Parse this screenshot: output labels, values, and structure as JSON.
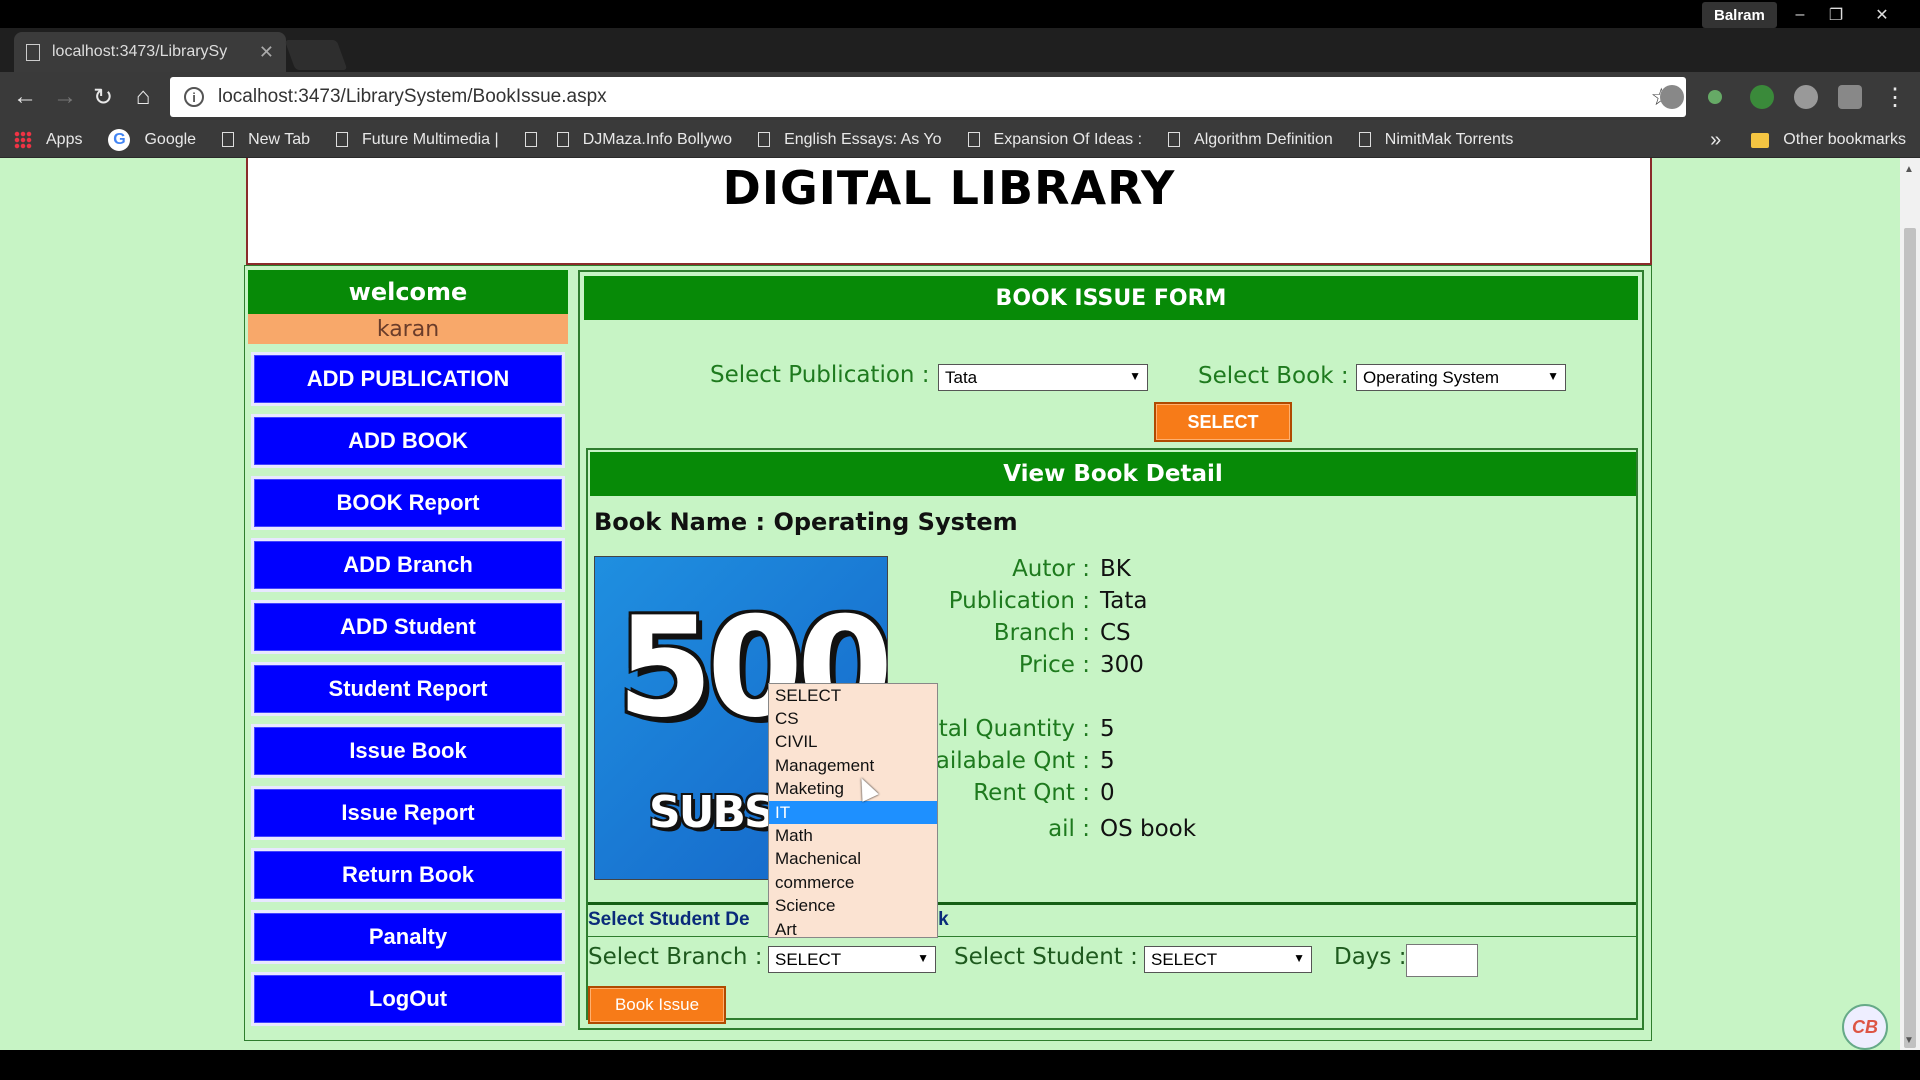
{
  "browser": {
    "tab_title": "localhost:3473/LibrarySy",
    "profile_name": "Balram",
    "url": "localhost:3473/LibrarySystem/BookIssue.aspx",
    "bookmarks": [
      {
        "label": "Apps"
      },
      {
        "label": "Google"
      },
      {
        "label": "New Tab"
      },
      {
        "label": "Future Multimedia |"
      },
      {
        "label": ""
      },
      {
        "label": "DJMaza.Info Bollywo"
      },
      {
        "label": "English Essays: As Yo"
      },
      {
        "label": "Expansion Of Ideas :"
      },
      {
        "label": "Algorithm Definition"
      },
      {
        "label": "NimitMak Torrents"
      }
    ],
    "overflow_label": "»",
    "other_bookmarks": "Other bookmarks"
  },
  "page": {
    "title": "DIGITAL LIBRARY"
  },
  "sidebar": {
    "welcome": "welcome",
    "username": "karan",
    "items": [
      {
        "label": "ADD PUBLICATION"
      },
      {
        "label": "ADD BOOK"
      },
      {
        "label": "BOOK Report"
      },
      {
        "label": "ADD Branch"
      },
      {
        "label": "ADD Student"
      },
      {
        "label": "Student Report"
      },
      {
        "label": "Issue Book"
      },
      {
        "label": "Issue Report"
      },
      {
        "label": "Return Book"
      },
      {
        "label": "Panalty"
      },
      {
        "label": "LogOut"
      }
    ]
  },
  "form": {
    "heading": "BOOK ISSUE FORM",
    "publication_label": "Select Publication :",
    "publication_value": "Tata",
    "book_label": "Select Book :",
    "book_value": "Operating System",
    "select_button": "SELECT"
  },
  "detail": {
    "heading": "View Book Detail",
    "book_name": "Book Name : Operating System",
    "cover_big": "500!",
    "cover_sub": "SUBSCRI",
    "rows": [
      {
        "key": "Autor :",
        "value": "BK"
      },
      {
        "key": "Publication :",
        "value": "Tata"
      },
      {
        "key": "Branch :",
        "value": "CS"
      },
      {
        "key": "Price :",
        "value": "300"
      },
      {
        "key": "otal Quantity :",
        "value": "5"
      },
      {
        "key": "vailabale Qnt :",
        "value": "5"
      },
      {
        "key": "Rent Qnt :",
        "value": "0"
      },
      {
        "key": "ail :",
        "value": "OS book"
      }
    ]
  },
  "issue": {
    "subhead_left": "Select Student De",
    "subhead_right": "ok",
    "branch_label": "Select Branch :",
    "branch_value": "SELECT",
    "student_label": "Select Student :",
    "student_value": "SELECT",
    "days_label": "Days :",
    "days_value": "",
    "issue_button": "Book Issue"
  },
  "branch_dropdown": {
    "options": [
      "SELECT",
      "CS",
      "CIVIL",
      "Management",
      "Maketing",
      "IT",
      "Math",
      "Machenical",
      "commerce",
      "Science",
      "Art"
    ],
    "highlighted": "IT"
  },
  "watermark": "CB"
}
